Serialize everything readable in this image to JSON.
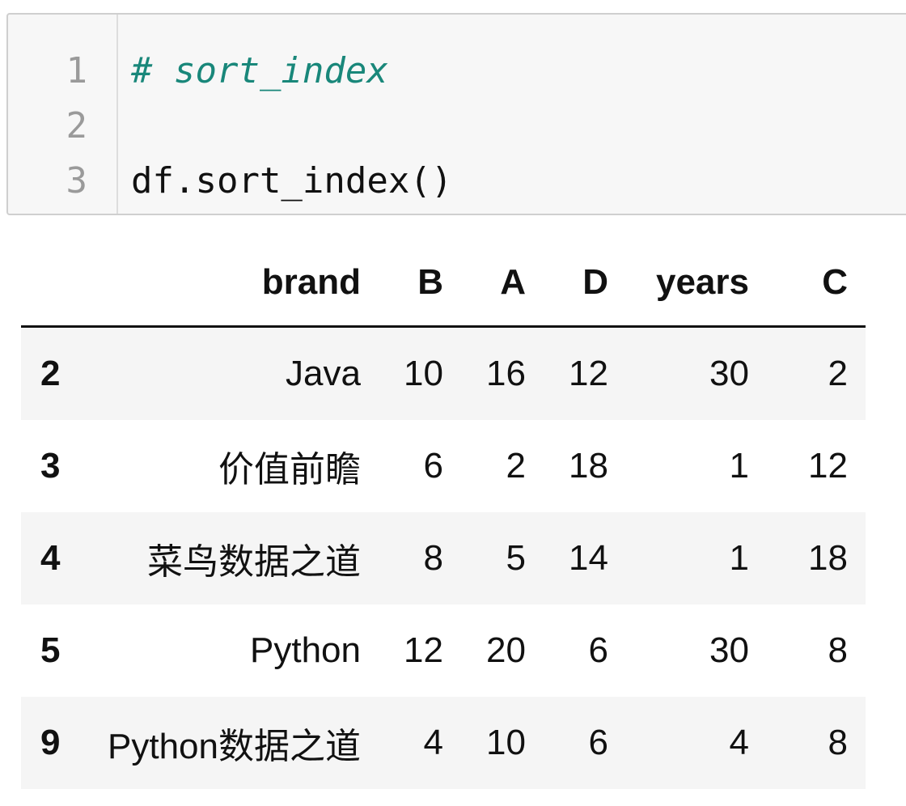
{
  "code_cell": {
    "line_numbers": [
      "1",
      "2",
      "3"
    ],
    "lines": [
      "# sort_index",
      "",
      "df.sort_index()"
    ]
  },
  "table": {
    "index_header": "",
    "columns": [
      "brand",
      "B",
      "A",
      "D",
      "years",
      "C"
    ],
    "rows": [
      {
        "index": "2",
        "brand": "Java",
        "B": "10",
        "A": "16",
        "D": "12",
        "years": "30",
        "C": "2"
      },
      {
        "index": "3",
        "brand": "价值前瞻",
        "B": "6",
        "A": "2",
        "D": "18",
        "years": "1",
        "C": "12"
      },
      {
        "index": "4",
        "brand": "菜鸟数据之道",
        "B": "8",
        "A": "5",
        "D": "14",
        "years": "1",
        "C": "18"
      },
      {
        "index": "5",
        "brand": "Python",
        "B": "12",
        "A": "20",
        "D": "6",
        "years": "30",
        "C": "8"
      },
      {
        "index": "9",
        "brand": "Python数据之道",
        "B": "4",
        "A": "10",
        "D": "6",
        "years": "4",
        "C": "8"
      }
    ]
  },
  "colors": {
    "comment": "#19877a",
    "line_number": "#9a9a9a",
    "code_bg": "#f7f7f7",
    "stripe": "#f5f5f5"
  }
}
